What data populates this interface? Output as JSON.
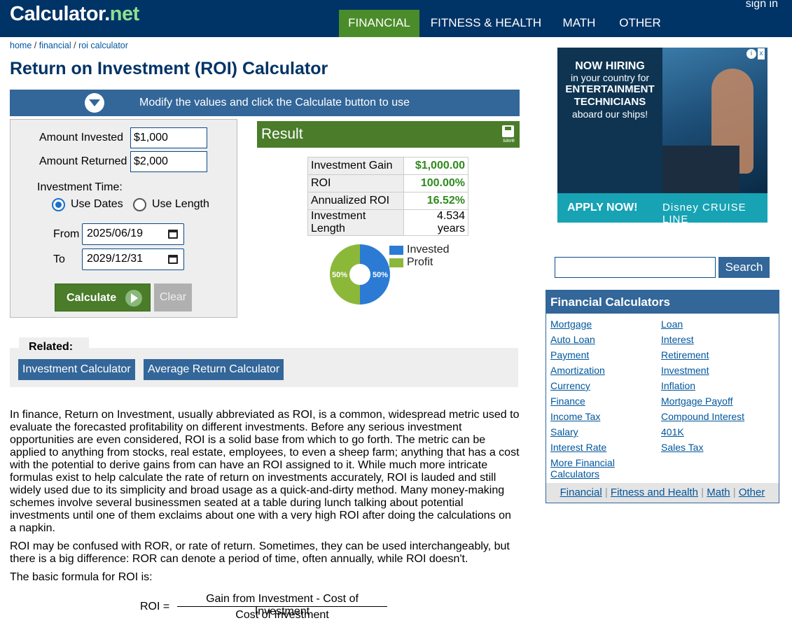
{
  "header": {
    "logo_main": "Calculator",
    "logo_dot": ".",
    "logo_net": "net",
    "sign_in": "sign in",
    "nav": [
      "FINANCIAL",
      "FITNESS & HEALTH",
      "MATH",
      "OTHER"
    ]
  },
  "breadcrumb": {
    "home": "home",
    "sep": "/",
    "financial": "financial",
    "current": "roi calculator"
  },
  "page_title": "Return on Investment (ROI) Calculator",
  "modify_bar": "Modify the values and click the Calculate button to use",
  "form": {
    "amount_invested_label": "Amount Invested",
    "amount_invested_value": "$1,000",
    "amount_returned_label": "Amount Returned",
    "amount_returned_value": "$2,000",
    "investment_time_label": "Investment Time:",
    "use_dates_label": "Use Dates",
    "use_length_label": "Use Length",
    "from_label": "From",
    "from_value": "2025/06/19",
    "to_label": "To",
    "to_value": "2029/12/31",
    "calculate_label": "Calculate",
    "clear_label": "Clear"
  },
  "result": {
    "title": "Result",
    "save_label": "save",
    "rows": [
      {
        "label": "Investment Gain",
        "value": "$1,000.00",
        "green": true
      },
      {
        "label": "ROI",
        "value": "100.00%",
        "green": true
      },
      {
        "label": "Annualized ROI",
        "value": "16.52%",
        "green": true
      },
      {
        "label": "Investment Length",
        "value": "4.534 years",
        "green": false
      }
    ]
  },
  "chart_data": {
    "type": "pie",
    "categories": [
      "Invested",
      "Profit"
    ],
    "values": [
      50,
      50
    ],
    "labels": [
      "50%",
      "50%"
    ],
    "colors": {
      "Invested": "#2b7bd4",
      "Profit": "#8cb83a"
    },
    "legend": "right"
  },
  "related": {
    "title": "Related:",
    "buttons": [
      "Investment Calculator",
      "Average Return Calculator"
    ]
  },
  "body": {
    "p1": "In finance, Return on Investment, usually abbreviated as ROI, is a common, widespread metric used to evaluate the forecasted profitability on different investments. Before any serious investment opportunities are even considered, ROI is a solid base from which to go forth. The metric can be applied to anything from stocks, real estate, employees, to even a sheep farm; anything that has a cost with the potential to derive gains from can have an ROI assigned to it. While much more intricate formulas exist to help calculate the rate of return on investments accurately, ROI is lauded and still widely used due to its simplicity and broad usage as a quick-and-dirty method. Many money-making schemes involve several businessmen seated at a table during lunch talking about potential investments until one of them exclaims about one with a very high ROI after doing the calculations on a napkin.",
    "p2": "ROI may be confused with ROR, or rate of return. Sometimes, they can be used interchangeably, but there is a big difference: ROR can denote a period of time, often annually, while ROI doesn't.",
    "p3": "The basic formula for ROI is:",
    "formula_lhs": "ROI =",
    "formula_num": "Gain from Investment - Cost of Investment",
    "formula_den": "Cost of Investment"
  },
  "ad": {
    "l1": "NOW HIRING",
    "l2": "in your country for",
    "l3": "ENTERTAINMENT",
    "l4": "TECHNICIANS",
    "l5": "aboard our ships!",
    "apply": "APPLY NOW!",
    "brand": "Disney CRUISE LINE",
    "info": "i",
    "close": "x"
  },
  "search": {
    "button": "Search",
    "value": ""
  },
  "financial_box": {
    "title": "Financial Calculators",
    "left": [
      "Mortgage",
      "Auto Loan",
      "Payment",
      "Amortization",
      "Currency",
      "Finance",
      "Income Tax",
      "Salary",
      "Interest Rate"
    ],
    "right": [
      "Loan",
      "Interest",
      "Retirement",
      "Investment",
      "Inflation",
      "Mortgage Payoff",
      "Compound Interest",
      "401K",
      "Sales Tax"
    ],
    "more_1": "More Financial",
    "more_2": "Calculators",
    "footer": [
      "Financial",
      "Fitness and Health",
      "Math",
      "Other"
    ],
    "footer_sep": "|"
  }
}
